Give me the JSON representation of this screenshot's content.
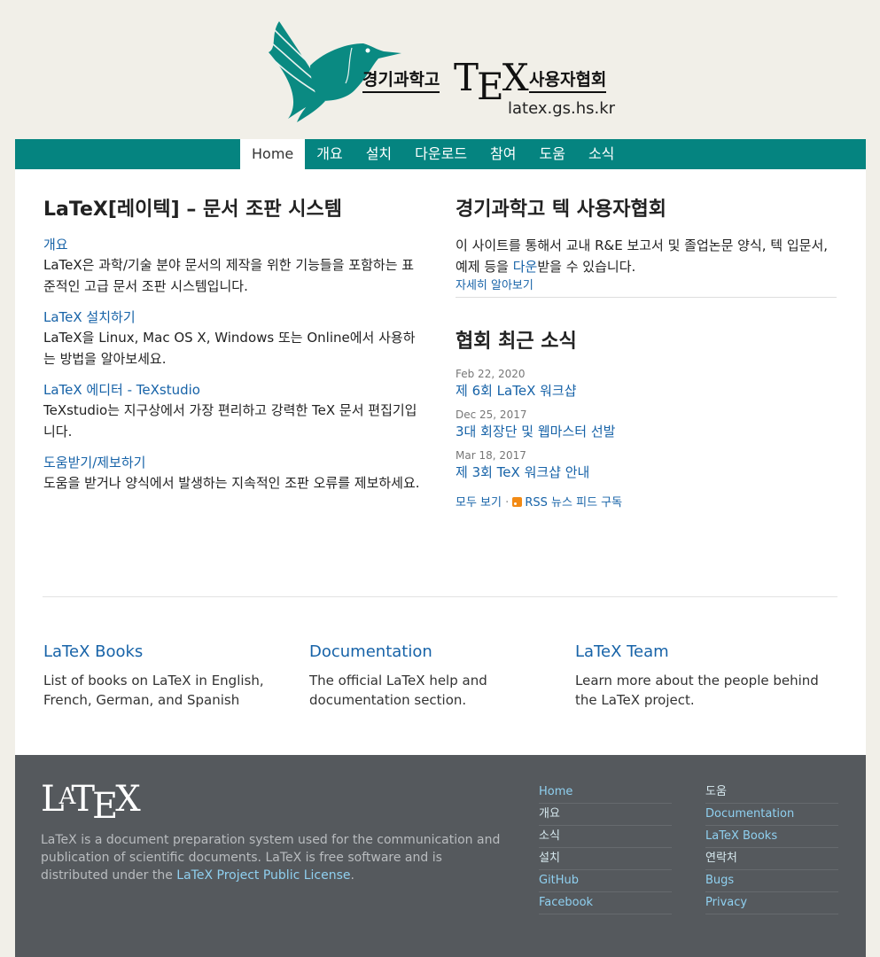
{
  "header": {
    "logo_left": "경기과학고",
    "logo_right": "사용자협회",
    "logo_url": "latex.gs.hs.kr"
  },
  "nav": {
    "items": [
      {
        "label": "Home",
        "active": true
      },
      {
        "label": "개요"
      },
      {
        "label": "설치"
      },
      {
        "label": "다운로드"
      },
      {
        "label": "참여"
      },
      {
        "label": "도움"
      },
      {
        "label": "소식"
      }
    ]
  },
  "main": {
    "left": {
      "title": "LaTeX[레이텍] – 문서 조판 시스템",
      "items": [
        {
          "link": "개요",
          "desc": "LaTeX은 과학/기술 분야 문서의 제작을 위한 기능들을 포함하는 표준적인 고급 문서 조판 시스템입니다."
        },
        {
          "link": "LaTeX 설치하기",
          "desc": "LaTeX을 Linux, Mac OS X, Windows 또는 Online에서 사용하는 방법을 알아보세요."
        },
        {
          "link": "LaTeX 에디터 - TeXstudio",
          "desc": "TeXstudio는 지구상에서 가장 편리하고 강력한 TeX 문서 편집기입니다."
        },
        {
          "link": "도움받기/제보하기",
          "desc": "도움을 받거나 양식에서 발생하는 지속적인 조판 오류를 제보하세요."
        }
      ]
    },
    "right": {
      "title": "경기과학고 텍 사용자협회",
      "intro_before": "이 사이트를 통해서 교내 R&E 보고서 및 졸업논문 양식, 텍 입문서, 예제 등을 ",
      "intro_link": "다운",
      "intro_after": "받을 수 있습니다.",
      "more": "자세히 알아보기",
      "news_title": "협회 최근 소식",
      "news": [
        {
          "date": "Feb 22, 2020",
          "title": "제 6회 LaTeX 워크샵"
        },
        {
          "date": "Dec 25, 2017",
          "title": "3대 회장단 및 웹마스터 선발"
        },
        {
          "date": "Mar 18, 2017",
          "title": "제 3회 TeX 워크샵 안내"
        }
      ],
      "view_all": "모두 보기",
      "separator": " · ",
      "rss": "RSS 뉴스 피드 구독"
    }
  },
  "cards": [
    {
      "title": "LaTeX Books",
      "desc": "List of books on LaTeX in English, French, German, and Spanish"
    },
    {
      "title": "Documentation",
      "desc": "The official LaTeX help and documentation section."
    },
    {
      "title": "LaTeX Team",
      "desc": "Learn more about the people behind the LaTeX project."
    }
  ],
  "footer": {
    "text_before": "LaTeX is a document preparation system used for the communication and publication of scientific documents. LaTeX is free software and is distributed under the ",
    "license_link": "LaTeX Project Public License",
    "text_after": ".",
    "col1": [
      "Home",
      "개요",
      "소식",
      "설치",
      "GitHub",
      "Facebook"
    ],
    "col2": [
      "도움",
      "Documentation",
      "LaTeX Books",
      "연락처",
      "Bugs",
      "Privacy"
    ]
  },
  "colors": {
    "nav_bg": "#058480",
    "link": "#1763a8",
    "footer_bg": "#55595d",
    "footer_link": "#8fd0f0",
    "rss": "#f28a14"
  }
}
